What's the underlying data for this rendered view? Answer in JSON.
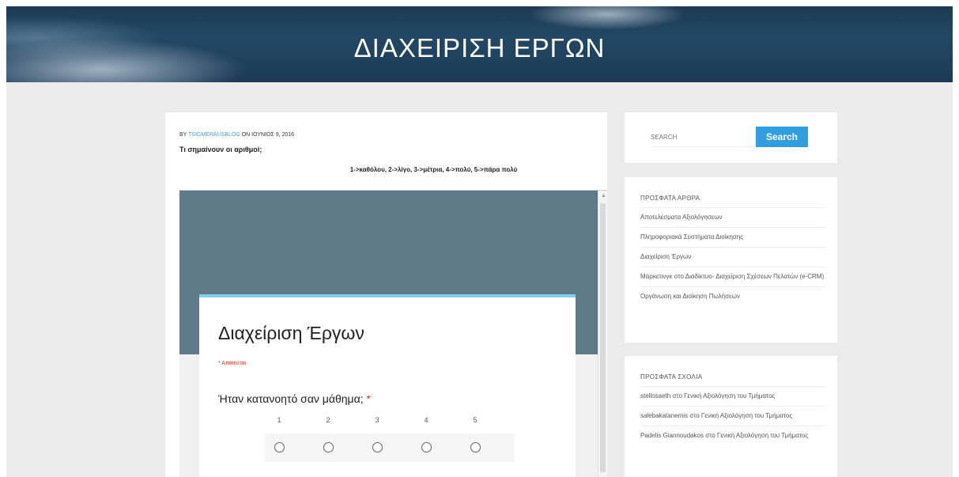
{
  "banner": {
    "title": "ΔΙΑΧΕΙΡΙΣΗ ΕΡΓΩΝ"
  },
  "post": {
    "meta_prefix": "BY ",
    "author": "TSIGMERAUSBLOG",
    "meta_suffix": " ON ΙΟΥΝΙΟΣ 9, 2016",
    "question": "Τι σημαίνουν οι αριθμοί;",
    "scale_text": "1->καθόλου, 2->λίγο, 3->μέτρια, 4->πολύ, 5->πάρα πολύ"
  },
  "form": {
    "title": "Διαχείριση Έργων",
    "required_note": "* Απαιτείται",
    "question": "Ήταν κατανοητό σαν μάθημα;",
    "required_star": "*",
    "scale": [
      "1",
      "2",
      "3",
      "4",
      "5"
    ]
  },
  "search": {
    "placeholder": "SEARCH",
    "button_label": "Search"
  },
  "recent_posts": {
    "title": "ΠΡΟΣΦΑΤΑ ΑΡΘΡΑ",
    "items": [
      "Αποτελέσματα Αξιολόγησεων",
      "Πληροφοριακά Συστήματα Διοίκησης",
      "Διαχείριση Έργων",
      "Μάρκετινγκ στο Διαδίκτυο- Διαχείριση Σχέσεων Πελατών (e-CRM)",
      "Οργάνωση και Διοίκηση Πωλήσεων"
    ]
  },
  "recent_comments": {
    "title": "ΠΡΟΣΦΑΤΑ ΣΧΟΛΙΑ",
    "items": [
      "stellosaeth στο Γενική Αξιολόγηση του Τμήματος",
      "salebakatanemis στο Γενική Αξιολόγηση του Τμήματος",
      "Padelis Giannoudakos στο Γενική Αξιολόγηση του Τμήματος"
    ]
  },
  "icons": {
    "scroll_up": "scroll-up-arrow-icon"
  }
}
